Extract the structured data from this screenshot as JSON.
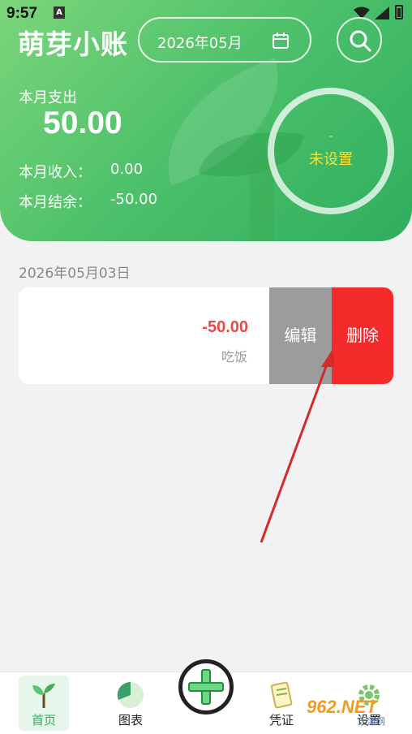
{
  "status_bar": {
    "time": "9:57",
    "notification_badge": "A"
  },
  "header": {
    "app_title": "萌芽小账",
    "month_selector": "2026年05月",
    "icons": {
      "calendar": "calendar-icon",
      "search": "search-icon"
    }
  },
  "summary": {
    "expense_label": "本月支出",
    "expense_value": "50.00",
    "income_label": "本月收入：",
    "income_value": "0.00",
    "balance_label": "本月结余：",
    "balance_value": "-50.00",
    "budget": {
      "dash": "-",
      "status": "未设置"
    }
  },
  "records": {
    "date": "2026年05月03日",
    "items": [
      {
        "amount": "-50.00",
        "note": "吃饭",
        "edit_label": "编辑",
        "delete_label": "删除"
      }
    ]
  },
  "bottom_nav": {
    "items": [
      {
        "label": "首页",
        "icon": "sprout-icon"
      },
      {
        "label": "图表",
        "icon": "pie-chart-icon"
      },
      {
        "label": "凭证",
        "icon": "voucher-icon"
      },
      {
        "label": "设置",
        "icon": "gear-icon"
      }
    ],
    "add_icon": "plus-icon"
  },
  "watermark": {
    "text": "962.NET",
    "sub": "乐游网"
  },
  "colors": {
    "accent_green": "#4cc06a",
    "delete_red": "#f52a2a",
    "edit_gray": "#9c9c9c",
    "amount_red": "#e84a4a",
    "budget_yellow": "#f2e23a"
  }
}
